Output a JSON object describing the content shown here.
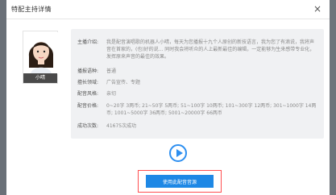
{
  "modal": {
    "title": "特配主持详情",
    "close_glyph": "×"
  },
  "avatar": {
    "name": "小晴"
  },
  "details": [
    {
      "label": "主播介绍:",
      "value": "我是配音演唱歌的机器人小晴，每天为您播报十九个人原创的新技语言，我为您了有滴说，我将声音在首家的，(也)好的说... 同时我会将听众的人上最新最佳的编辑，一定能够为生来感带专业化，发挥原来声音的最佳的效果。"
    },
    {
      "label": "播报语种:",
      "value": "普通"
    },
    {
      "label": "擅长领域:",
      "value": "广告宣传、专题"
    },
    {
      "label": "配音风格:",
      "value": "亲切"
    },
    {
      "label": "配音价格:",
      "value": "0~20字 3两币; 21~50字 5两币; 51~100字 10两币; 101~300字 12两币; 301~1000字 14两币; 1001~5000字 36两币; 5001~20000字 66两币"
    },
    {
      "label": "成功次数:",
      "value": "41675次成功"
    }
  ],
  "actions": {
    "use_button": "使用此配音音源"
  },
  "colors": {
    "accent": "#1e88e5",
    "highlight_border": "#ff4d4f",
    "panel_bg": "#f0f1f3"
  }
}
